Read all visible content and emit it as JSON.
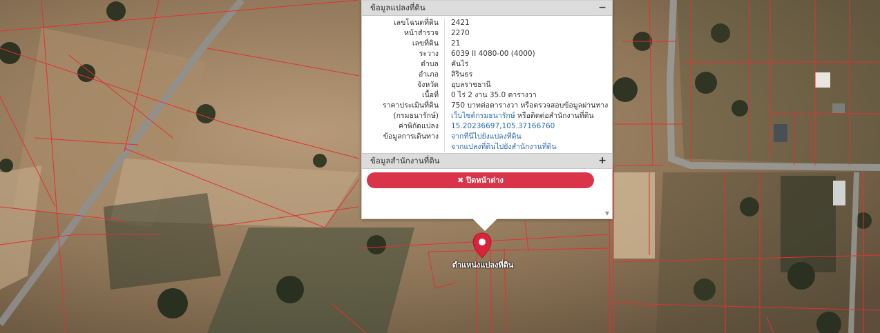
{
  "popup": {
    "section1_title": "ข้อมูลแปลงที่ดิน",
    "section1_toggle": "−",
    "rows": [
      {
        "label": "เลขโฉนดที่ดิน",
        "value": "2421"
      },
      {
        "label": "หน้าสำรวจ",
        "value": "2270"
      },
      {
        "label": "เลขที่ดิน",
        "value": "21"
      },
      {
        "label": "ระวาง",
        "value": "6039 II 4080-00 (4000)"
      },
      {
        "label": "ตำบล",
        "value": "คันไร่"
      },
      {
        "label": "อำเภอ",
        "value": "สิรินธร"
      },
      {
        "label": "จังหวัด",
        "value": "อุบลราชธานี"
      },
      {
        "label": "เนื้อที่",
        "value": "0 ไร่ 2 งาน 35.0 ตารางวา"
      }
    ],
    "price": {
      "label1": "ราคาประเมินที่ดิน",
      "label2": "(กรมธนารักษ์)",
      "value1": "750 บาทต่อตารางวา หรือตรวจสอบข้อมูลผ่านทาง",
      "value2_link": "เว็บไซต์กรมธนารักษ์",
      "value2_rest": " หรือติดต่อสำนักงานที่ดิน"
    },
    "coords": {
      "label": "ค่าพิกัดแปลง",
      "value": "15.20236697,105.37166760"
    },
    "directions": {
      "label": "ข้อมูลการเดินทาง",
      "link1": "จากที่นี่ไปยังแปลงที่ดิน",
      "link2": "จากแปลงที่ดินไปยังสำนักงานที่ดิน"
    },
    "section2_title": "ข้อมูลสำนักงานที่ดิน",
    "section2_toggle": "+",
    "close_label": "✖ ปิดหน้าต่าง",
    "scroll_arrow": "▼"
  },
  "marker": {
    "label": "ตำแหน่งแปลงที่ดิน",
    "color": "#d9233a"
  },
  "colors": {
    "parcel_lines": "#e53030",
    "road": "#8e9090",
    "accent": "#d9344a",
    "link": "#2a6bb0"
  }
}
